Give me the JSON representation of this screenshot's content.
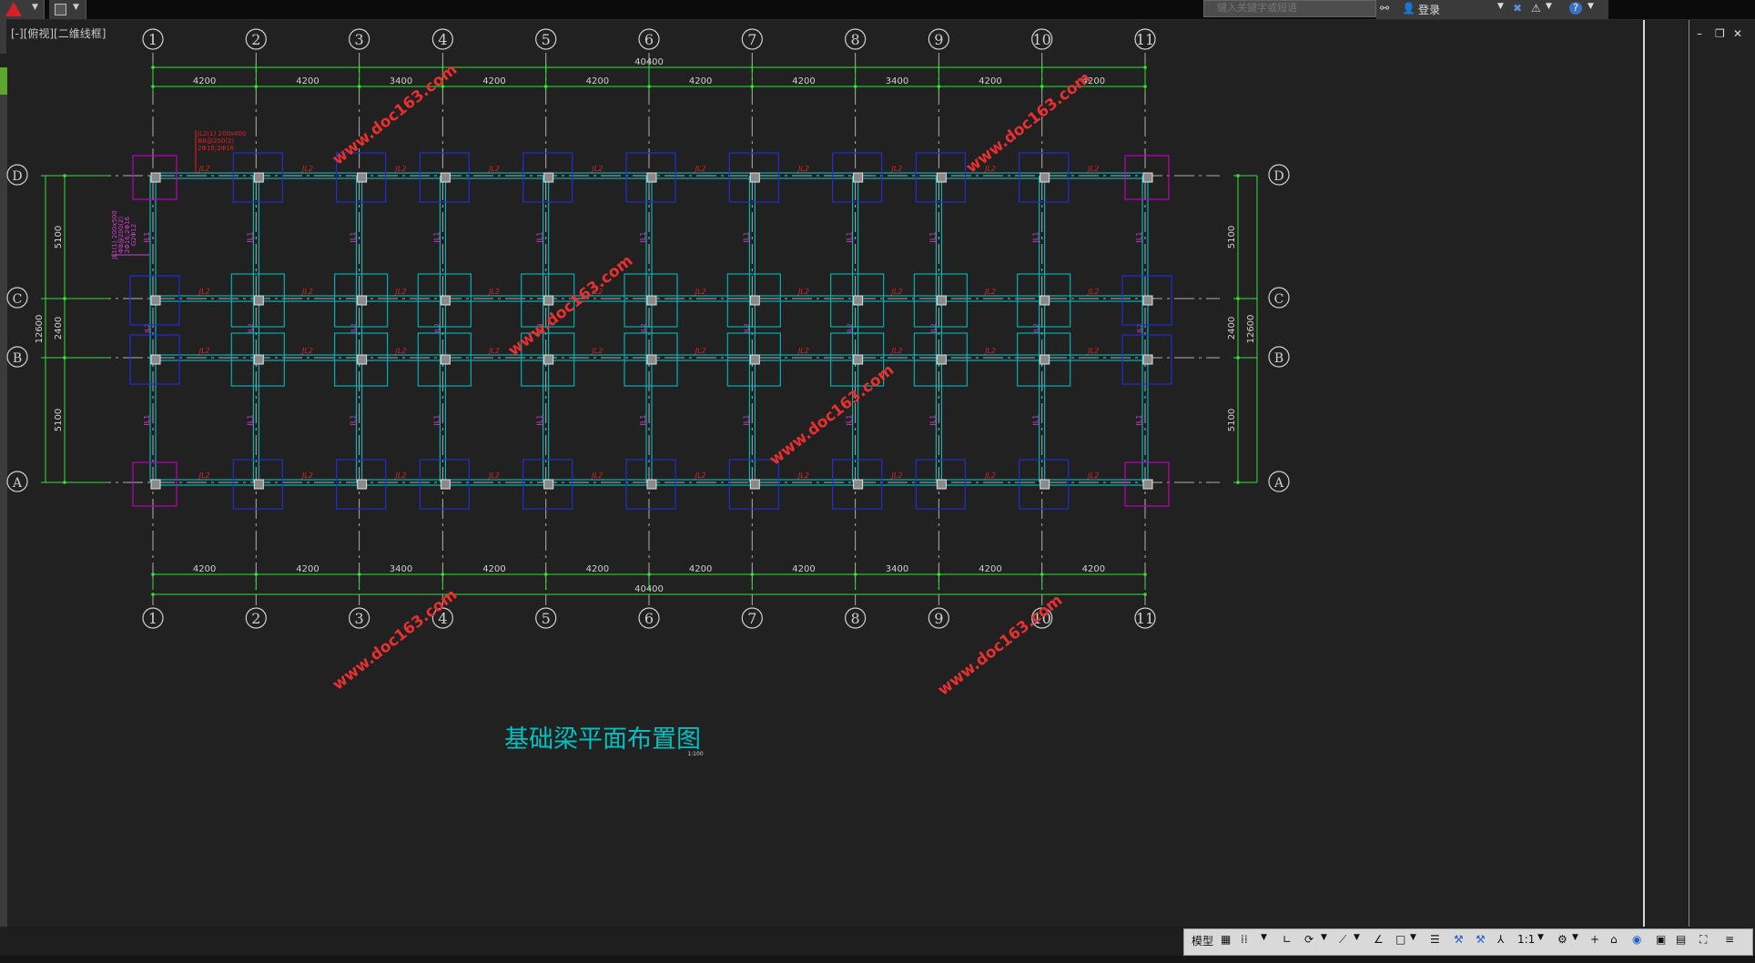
{
  "search": {
    "placeholder": "键入关键字或短语"
  },
  "account": {
    "login_label": "登录"
  },
  "viewport": {
    "label": "[-][俯视][二维线框]"
  },
  "drawing": {
    "title": "基础梁平面布置图",
    "subtitle": "1:100",
    "grid_top": [
      "1",
      "2",
      "3",
      "4",
      "5",
      "6",
      "7",
      "8",
      "9",
      "10",
      "11"
    ],
    "grid_left": [
      "D",
      "C",
      "B",
      "A"
    ],
    "spans": [
      "4200",
      "4200",
      "3400",
      "4200",
      "4200",
      "4200",
      "4200",
      "3400",
      "4200",
      "4200"
    ],
    "total_length": "40400",
    "vertical_spans": [
      "5100",
      "2400",
      "5100"
    ],
    "total_width": "12600",
    "beam_label_h": "JL2",
    "beam_label_v": "JL1",
    "annotation_jl2": [
      "JL2(1) 200x400",
      "Φ8@200(2)",
      "2Φ16;2Φ16"
    ],
    "annotation_jl1": [
      "JL1(1) 200x500",
      "Φ8@200(2)",
      "2Φ16;2Φ16",
      "G2Φ12"
    ],
    "watermark": "www.doc163.com"
  },
  "status": {
    "model_tab": "模型",
    "scale": "1:1"
  },
  "colors": {
    "background": "#212121",
    "grid_line": "#b0b0b0",
    "dimension": "#35e135",
    "beam": "#00d0d0",
    "beam_label": "#e02020",
    "corner_footing": "#c000c0",
    "edge_footing": "#1e2fd0",
    "inner_footing": "#00b0b0",
    "title": "#00c0c0",
    "watermark": "#e83030"
  }
}
